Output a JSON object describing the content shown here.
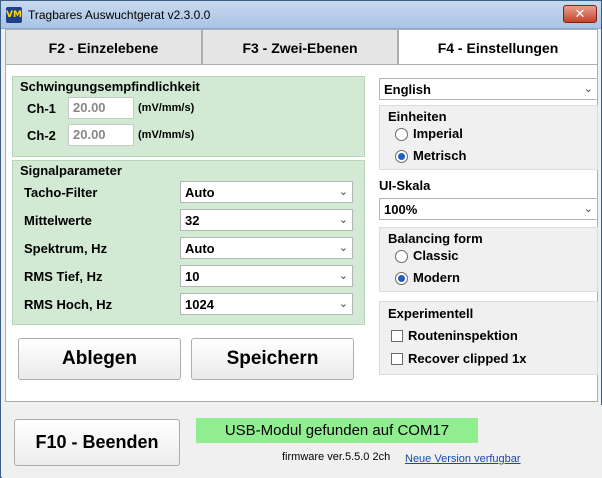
{
  "window": {
    "title": "Tragbares Auswuchtgerat v2.3.0.0",
    "app_icon": "VM",
    "close_glyph": "✕"
  },
  "tabs": [
    {
      "label": "F2 - Einzelebene",
      "active": false
    },
    {
      "label": "F3 - Zwei-Ebenen",
      "active": false
    },
    {
      "label": "F4 - Einstellungen",
      "active": true
    }
  ],
  "sensitivity": {
    "title": "Schwingungsempfindlichkeit",
    "channels": [
      {
        "label": "Ch-1",
        "value": "20.00",
        "unit": "(mV/mm/s)"
      },
      {
        "label": "Ch-2",
        "value": "20.00",
        "unit": "(mV/mm/s)"
      }
    ]
  },
  "signal": {
    "title": "Signalparameter",
    "params": [
      {
        "label": "Tacho-Filter",
        "value": "Auto"
      },
      {
        "label": "Mittelwerte",
        "value": "32"
      },
      {
        "label": "Spektrum, Hz",
        "value": "Auto"
      },
      {
        "label": "RMS Tief, Hz",
        "value": "10"
      },
      {
        "label": "RMS Hoch, Hz",
        "value": "1024"
      }
    ]
  },
  "buttons": {
    "discard": "Ablegen",
    "save": "Speichern",
    "quit": "F10 - Beenden"
  },
  "language": {
    "value": "English"
  },
  "units": {
    "title": "Einheiten",
    "options": [
      {
        "label": "Imperial",
        "checked": false
      },
      {
        "label": "Metrisch",
        "checked": true
      }
    ]
  },
  "ui_scale": {
    "title": "UI-Skala",
    "value": "100%"
  },
  "balancing_form": {
    "title": "Balancing form",
    "options": [
      {
        "label": "Classic",
        "checked": false
      },
      {
        "label": "Modern",
        "checked": true
      }
    ]
  },
  "experimental": {
    "title": "Experimentell",
    "options": [
      {
        "label": "Routeninspektion",
        "checked": false
      },
      {
        "label": "Recover clipped 1x",
        "checked": false
      }
    ]
  },
  "status": {
    "usb": "USB-Modul gefunden auf COM17",
    "firmware": "firmware ver.5.5.0 2ch",
    "update_link": "Neue Version verfugbar"
  },
  "colors": {
    "group_bg": "#d2ead3",
    "status_ok": "#90ee90",
    "link": "#1a4aa5"
  },
  "icons": {
    "dropdown": "chevron-down-icon",
    "close": "close-icon",
    "app": "app-logo-icon"
  }
}
